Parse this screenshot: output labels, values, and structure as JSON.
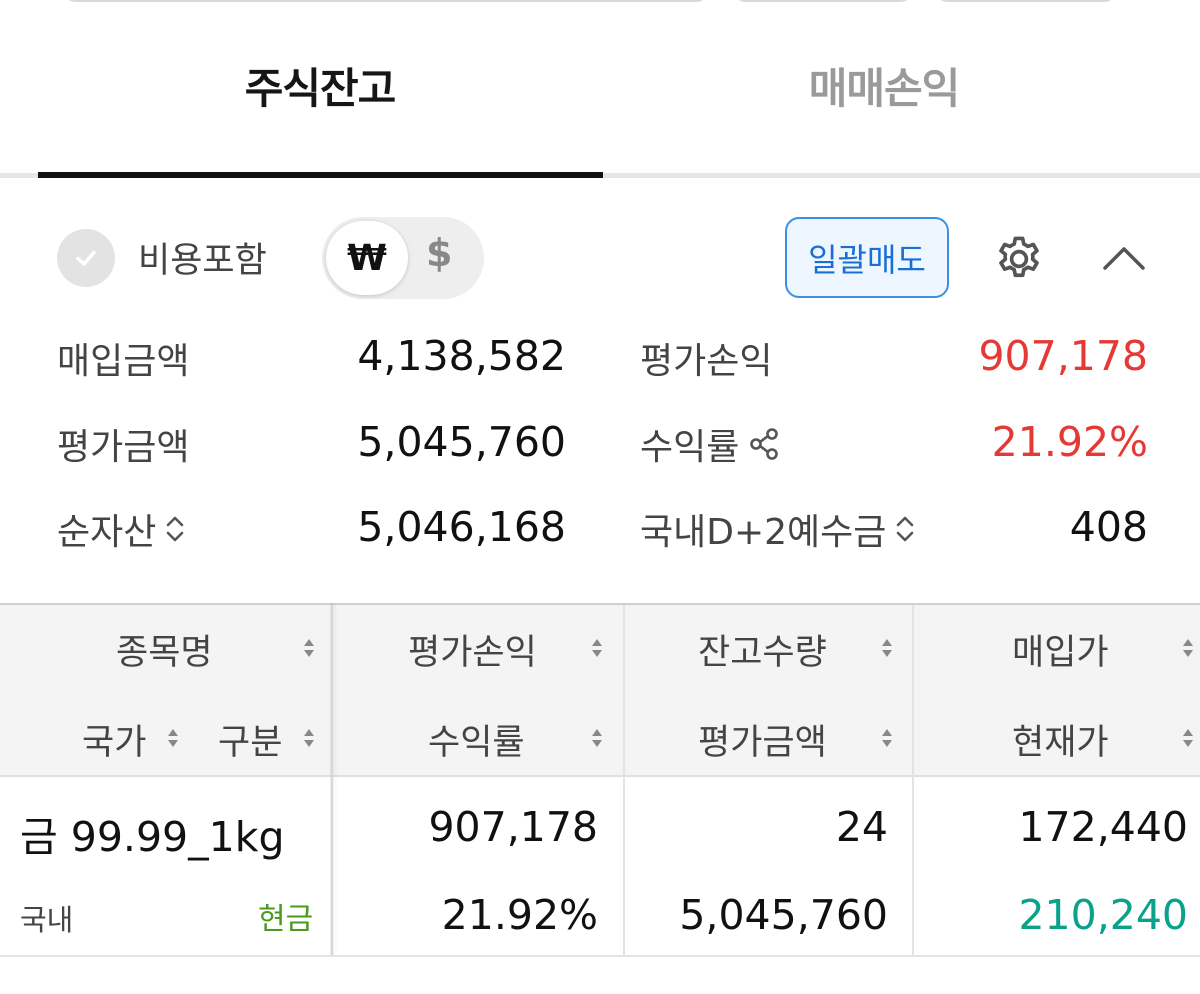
{
  "tabs": [
    {
      "label": "주식잔고",
      "active": true
    },
    {
      "label": "매매손익",
      "active": false
    }
  ],
  "options": {
    "include_cost_label": "비용포함",
    "include_cost_checked": false,
    "currency_krw": "₩",
    "currency_usd": "$",
    "selected_currency": "KRW",
    "bulk_sell_label": "일괄매도",
    "settings_icon": "gear-icon",
    "collapse_icon": "chevron-up-icon"
  },
  "summary": {
    "purchase_amount": {
      "label": "매입금액",
      "value": "4,138,582"
    },
    "eval_amount": {
      "label": "평가금액",
      "value": "5,045,760"
    },
    "net_asset": {
      "label": "순자산",
      "value": "5,046,168"
    },
    "eval_pnl": {
      "label": "평가손익",
      "value": "907,178"
    },
    "return_rate": {
      "label": "수익률",
      "value": "21.92%"
    },
    "deposit": {
      "label": "국내D+2예수금",
      "value": "408"
    }
  },
  "table": {
    "headers": {
      "name": "종목명",
      "country": "국가",
      "type": "구분",
      "eval_pnl": "평가손익",
      "return_rate": "수익률",
      "quantity": "잔고수량",
      "eval_amount": "평가금액",
      "purchase_price": "매입가",
      "current_price": "현재가"
    },
    "rows": [
      {
        "name": "금 99.99_1kg",
        "country": "국내",
        "type": "현금",
        "eval_pnl": "907,178",
        "return_rate": "21.92%",
        "quantity": "24",
        "eval_amount": "5,045,760",
        "purchase_price": "172,440",
        "current_price": "210,240"
      }
    ]
  },
  "colors": {
    "profit": "#e53935",
    "current_price": "#0aa28a",
    "cash_type": "#4a9a1e",
    "accent": "#1a6fd6"
  }
}
